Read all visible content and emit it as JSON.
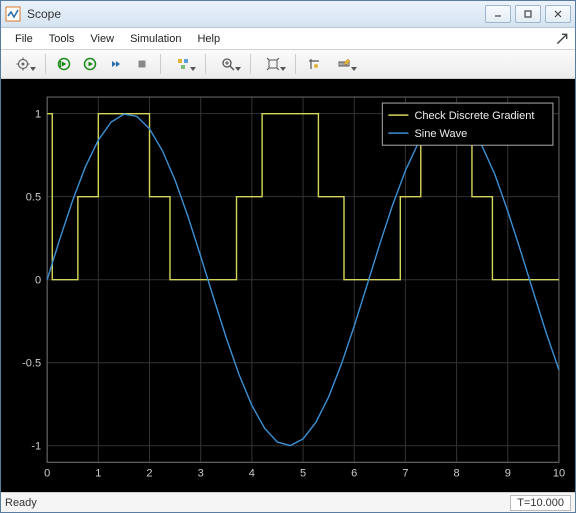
{
  "window": {
    "title": "Scope"
  },
  "menu": {
    "items": [
      "File",
      "Tools",
      "View",
      "Simulation",
      "Help"
    ]
  },
  "toolbar": {
    "icons": [
      "settings-icon",
      "restart-icon",
      "run-icon",
      "step-icon",
      "stop-icon",
      "highlight-icon",
      "zoom-icon",
      "pan-icon",
      "scale-icon",
      "measure-icon"
    ]
  },
  "status": {
    "ready": "Ready",
    "time": "T=10.000"
  },
  "legend": {
    "items": [
      {
        "label": "Check Discrete Gradient",
        "color": "#d6d658"
      },
      {
        "label": "Sine Wave",
        "color": "#3b8fd4"
      }
    ]
  },
  "axis": {
    "x_ticks": [
      "0",
      "1",
      "2",
      "3",
      "4",
      "5",
      "6",
      "7",
      "8",
      "9",
      "10"
    ],
    "y_ticks": [
      "-1",
      "-0.5",
      "0",
      "0.5",
      "1"
    ]
  },
  "chart_data": {
    "type": "line",
    "xlim": [
      0,
      10
    ],
    "ylim": [
      -1.1,
      1.1
    ],
    "xlabel": "",
    "ylabel": "",
    "title": "",
    "x_ticks": [
      0,
      1,
      2,
      3,
      4,
      5,
      6,
      7,
      8,
      9,
      10
    ],
    "y_ticks": [
      -1,
      -0.5,
      0,
      0.5,
      1
    ],
    "series": [
      {
        "name": "Check Discrete Gradient",
        "color": "#d6d658",
        "x": [
          0,
          0.1,
          0.1,
          0.6,
          0.6,
          1.0,
          1.0,
          2.0,
          2.0,
          2.4,
          2.4,
          3.7,
          3.7,
          4.2,
          4.2,
          5.3,
          5.3,
          5.8,
          5.8,
          6.9,
          6.9,
          7.3,
          7.3,
          8.3,
          8.3,
          8.7,
          8.7,
          10.0,
          10.0
        ],
        "y": [
          1,
          1,
          0,
          0,
          0.5,
          0.5,
          1,
          1,
          0.5,
          0.5,
          0,
          0,
          0.5,
          0.5,
          1,
          1,
          0.5,
          0.5,
          0,
          0,
          0.5,
          0.5,
          1,
          1,
          0.5,
          0.5,
          0,
          0,
          0
        ]
      },
      {
        "name": "Sine Wave",
        "color": "#3b8fd4",
        "function": "sin(x)",
        "x": [
          0,
          0.25,
          0.5,
          0.75,
          1,
          1.25,
          1.5,
          1.75,
          2,
          2.25,
          2.5,
          2.75,
          3,
          3.25,
          3.5,
          3.75,
          4,
          4.25,
          4.5,
          4.75,
          5,
          5.25,
          5.5,
          5.75,
          6,
          6.25,
          6.5,
          6.75,
          7,
          7.25,
          7.5,
          7.75,
          8,
          8.25,
          8.5,
          8.75,
          9,
          9.25,
          9.5,
          9.75,
          10
        ],
        "y": [
          0,
          0.247,
          0.479,
          0.682,
          0.841,
          0.949,
          0.997,
          0.984,
          0.909,
          0.778,
          0.599,
          0.382,
          0.141,
          -0.108,
          -0.351,
          -0.572,
          -0.757,
          -0.895,
          -0.978,
          -0.999,
          -0.959,
          -0.859,
          -0.706,
          -0.508,
          -0.279,
          -0.033,
          0.215,
          0.45,
          0.657,
          0.823,
          0.938,
          0.993,
          0.989,
          0.924,
          0.803,
          0.632,
          0.412,
          0.174,
          -0.075,
          -0.32,
          -0.544
        ]
      }
    ]
  }
}
